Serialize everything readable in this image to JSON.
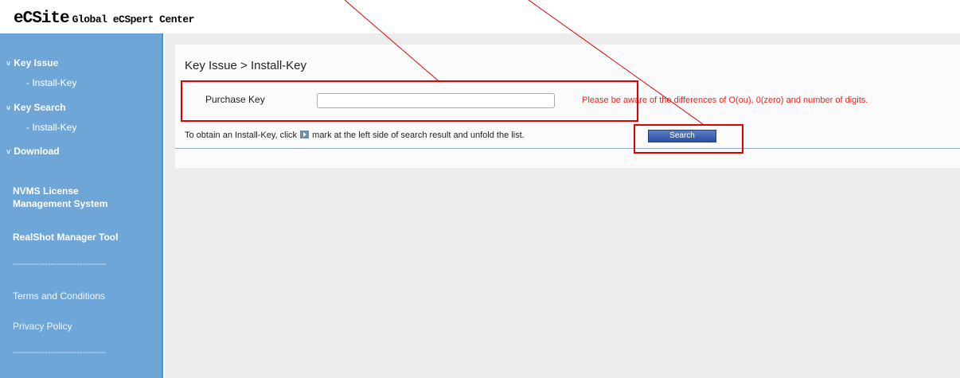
{
  "header": {
    "brand": "eCSite",
    "subtitle": "Global eCSpert Center"
  },
  "sidebar": {
    "key_issue": "Key Issue",
    "key_issue_sub": "- Install-Key",
    "key_search": "Key Search",
    "key_search_sub": "- Install-Key",
    "download": "Download",
    "nvms_line1": "NVMS License",
    "nvms_line2": "Management System",
    "realshot": "RealShot Manager Tool",
    "divider": "--------------------------------",
    "terms": "Terms and Conditions",
    "privacy": "Privacy Policy",
    "chevron": "˅"
  },
  "main": {
    "breadcrumb": "Key Issue > Install-Key",
    "purchase_key_label": "Purchase Key",
    "purchase_key_value": "",
    "warning": "Please be aware of the differences of O(ou), 0(zero) and number of digits.",
    "instruction_before": "To obtain an Install-Key, click",
    "instruction_after": "mark at the left side of search result and unfold the list.",
    "search_button": "Search"
  },
  "colors": {
    "sidebar": "#6fa6d8",
    "annotation": "#e00000",
    "warning": "#e8231f",
    "button": "#2e4f9e"
  }
}
